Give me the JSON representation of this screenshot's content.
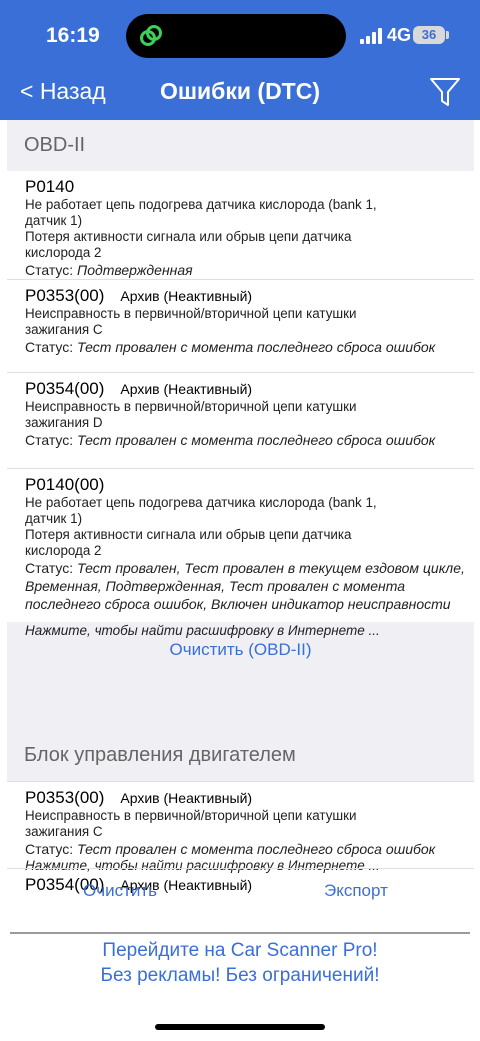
{
  "status_bar": {
    "time": "16:19",
    "network": "4G",
    "battery": "36"
  },
  "nav": {
    "back_label": "< Назад",
    "title": "Ошибки (DTC)"
  },
  "section1": {
    "title": "OBD-II",
    "items": [
      {
        "code": "P0140",
        "archive": "",
        "desc": [
          "Не работает цепь подогрева датчика кислорода (bank 1,",
          "датчик 1)",
          "Потеря активности сигнала или обрыв цепи датчика",
          "кислорода 2"
        ],
        "status_label": "Статус:",
        "status_value": "Подтвержденная"
      },
      {
        "code": "P0353(00)",
        "archive": "Архив (Неактивный)",
        "desc": [
          "Неисправность в первичной/вторичной цепи катушки",
          "зажигания C"
        ],
        "status_label": "Статус:",
        "status_value": "Тест провален с момента последнего сброса ошибок"
      },
      {
        "code": "P0354(00)",
        "archive": "Архив (Неактивный)",
        "desc": [
          "Неисправность в первичной/вторичной цепи катушки",
          "зажигания D"
        ],
        "status_label": "Статус:",
        "status_value": "Тест провален с момента последнего сброса ошибок"
      },
      {
        "code": "P0140(00)",
        "archive": "",
        "desc": [
          "Не работает цепь подогрева датчика кислорода (bank 1,",
          "датчик 1)",
          "Потеря активности сигнала или обрыв цепи датчика",
          "кислорода 2"
        ],
        "status_label": "Статус:",
        "status_value": "Тест провален, Тест провален в текущем ездовом цикле, Временная, Подтвержденная, Тест провален с момента последнего сброса ошибок, Включен индикатор неисправности"
      }
    ],
    "hint": "Нажмите, чтобы найти расшифровку в Интернете ...",
    "clear_label": "Очистить (OBD-II)"
  },
  "section2": {
    "title": "Блок управления двигателем",
    "items": [
      {
        "code": "P0353(00)",
        "archive": "Архив (Неактивный)",
        "desc": [
          "Неисправность в первичной/вторичной цепи катушки",
          "зажигания C"
        ],
        "status_label": "Статус:",
        "status_value": "Тест провален с момента последнего сброса ошибок"
      },
      {
        "code": "P0354(00)",
        "archive": "Архив (Неактивный)"
      }
    ],
    "hint": "Нажмите, чтобы найти расшифровку в Интернете ..."
  },
  "bottom": {
    "clear_label": "Очистить",
    "export_label": "Экспорт"
  },
  "promo": {
    "line1": "Перейдите на Car Scanner Pro!",
    "line2": "Без рекламы! Без ограничений!"
  },
  "colors": {
    "accent": "#3a6fd8",
    "section_bg": "#efeff4"
  }
}
